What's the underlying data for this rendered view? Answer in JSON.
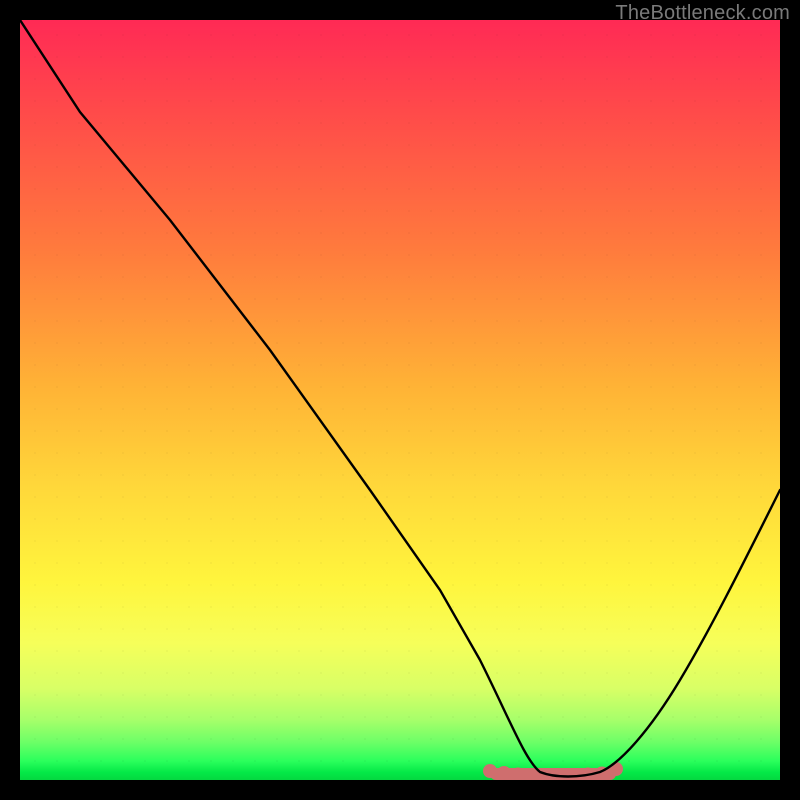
{
  "attribution": "TheBottleneck.com",
  "chart_data": {
    "type": "line",
    "title": "",
    "xlabel": "",
    "ylabel": "",
    "xlim": [
      0,
      100
    ],
    "ylim": [
      0,
      100
    ],
    "grid": false,
    "legend": false,
    "series": [
      {
        "name": "bottleneck-curve",
        "x": [
          0,
          10,
          20,
          30,
          40,
          50,
          55,
          60,
          65,
          68,
          70,
          72,
          75,
          80,
          85,
          90,
          95,
          100
        ],
        "values": [
          100,
          88,
          74,
          60,
          46,
          32,
          24,
          16,
          8,
          3,
          1,
          0.5,
          0.5,
          2,
          8,
          17,
          28,
          40
        ],
        "smoothness_note": "steep near-linear descent from top-left; flat trough around x≈68-78; moderate rise to right edge"
      }
    ],
    "annotations": [
      {
        "name": "trough-highlight",
        "shape": "bumpy-band",
        "color": "#d86b6b",
        "x_start": 62,
        "x_end": 80,
        "y": 0.6
      }
    ],
    "background_gradient": {
      "direction": "top-to-bottom",
      "stops": [
        {
          "pos": 0.0,
          "color": "#ff2a55"
        },
        {
          "pos": 0.3,
          "color": "#ff7a3d"
        },
        {
          "pos": 0.62,
          "color": "#ffd93a"
        },
        {
          "pos": 0.82,
          "color": "#f6ff5a"
        },
        {
          "pos": 0.95,
          "color": "#6dff67"
        },
        {
          "pos": 1.0,
          "color": "#04d840"
        }
      ]
    }
  }
}
